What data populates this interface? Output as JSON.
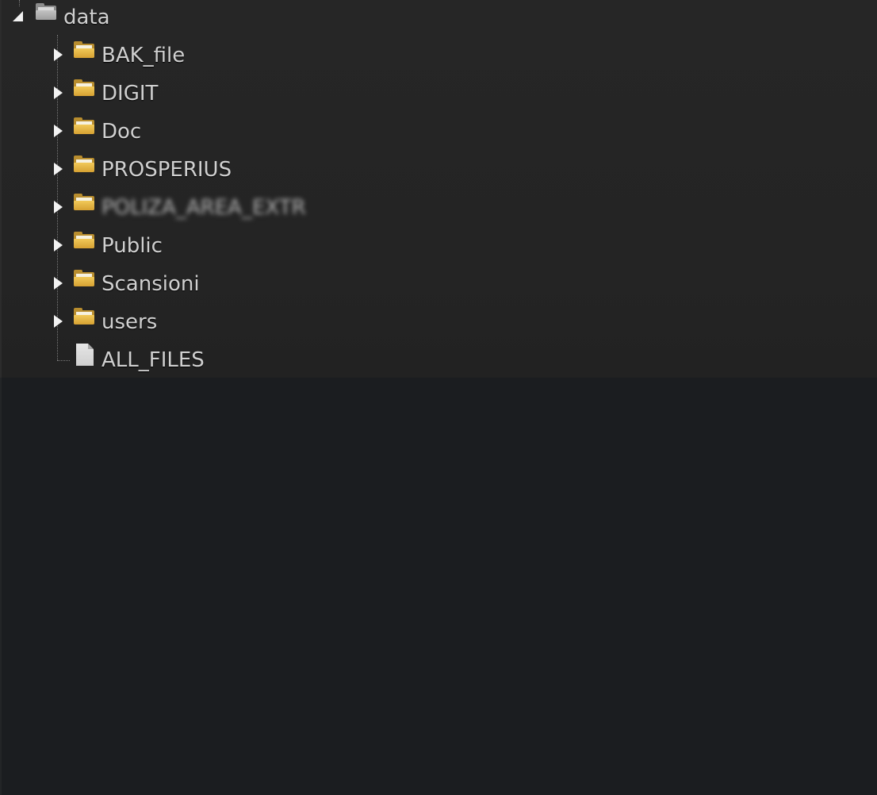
{
  "tree": {
    "root": {
      "label": "data",
      "icon": "folder-icon",
      "expanded": true
    },
    "children": [
      {
        "label": "BAK_file",
        "type": "folder",
        "icon": "folder-icon",
        "expanded": false
      },
      {
        "label": "DIGIT",
        "type": "folder",
        "icon": "folder-icon",
        "expanded": false
      },
      {
        "label": "Doc",
        "type": "folder",
        "icon": "folder-icon",
        "expanded": false
      },
      {
        "label": "PROSPERIUS",
        "type": "folder",
        "icon": "folder-icon",
        "expanded": false
      },
      {
        "label": "POLIZA_AREA_EXTR",
        "type": "folder",
        "icon": "folder-icon",
        "expanded": false,
        "redacted": true
      },
      {
        "label": "Public",
        "type": "folder",
        "icon": "folder-icon",
        "expanded": false
      },
      {
        "label": "Scansioni",
        "type": "folder",
        "icon": "folder-icon",
        "expanded": false
      },
      {
        "label": "users",
        "type": "folder",
        "icon": "folder-icon",
        "expanded": false
      },
      {
        "label": "ALL_FILES",
        "type": "file",
        "icon": "file-icon"
      }
    ]
  },
  "colors": {
    "panel_background": "#242424",
    "empty_background": "#1b1d20",
    "label_text": "#d0d0d0",
    "folder_accent": "#e0b043"
  }
}
